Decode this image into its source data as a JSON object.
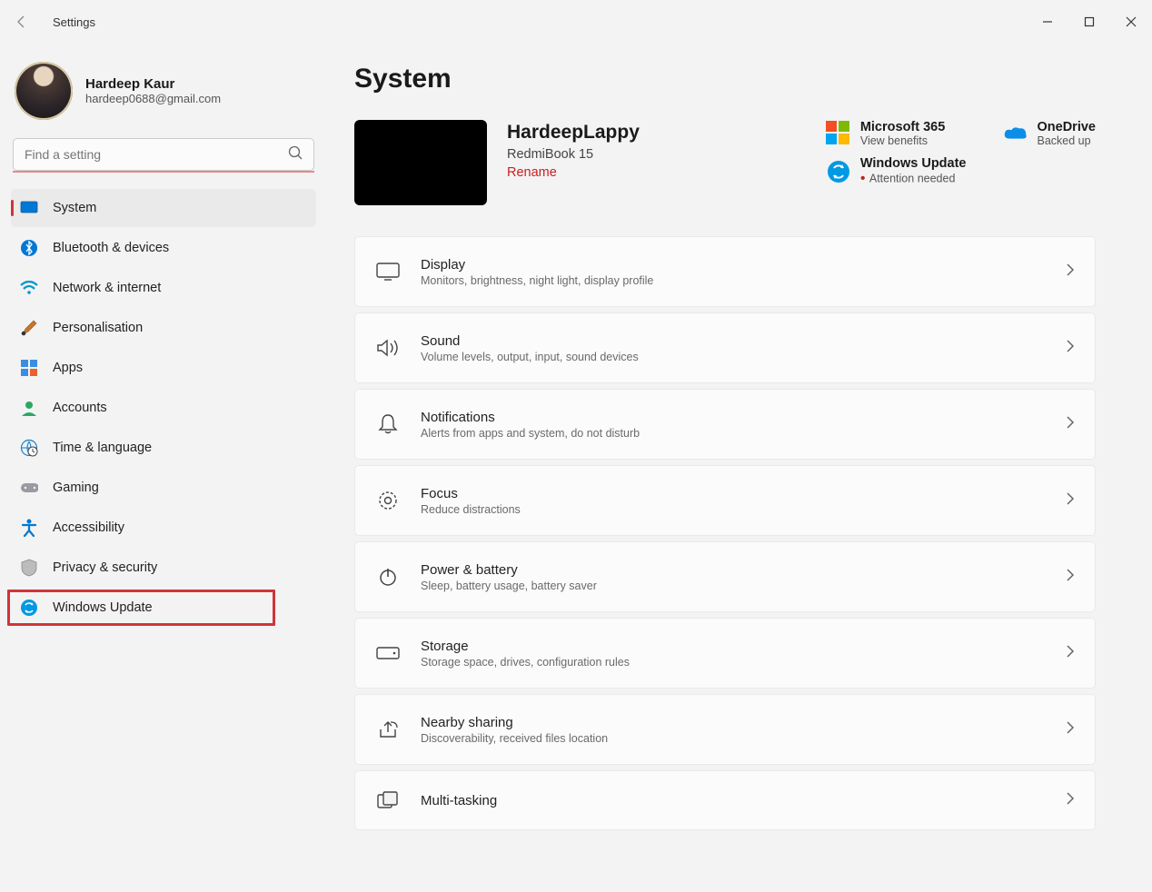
{
  "window": {
    "title": "Settings"
  },
  "profile": {
    "name": "Hardeep Kaur",
    "email": "hardeep0688@gmail.com"
  },
  "search": {
    "placeholder": "Find a setting"
  },
  "sidebar": {
    "items": [
      {
        "label": "System"
      },
      {
        "label": "Bluetooth & devices"
      },
      {
        "label": "Network & internet"
      },
      {
        "label": "Personalisation"
      },
      {
        "label": "Apps"
      },
      {
        "label": "Accounts"
      },
      {
        "label": "Time & language"
      },
      {
        "label": "Gaming"
      },
      {
        "label": "Accessibility"
      },
      {
        "label": "Privacy & security"
      },
      {
        "label": "Windows Update"
      }
    ]
  },
  "page": {
    "title": "System"
  },
  "device": {
    "name": "HardeepLappy",
    "model": "RedmiBook 15",
    "rename": "Rename"
  },
  "status": {
    "ms365": {
      "title": "Microsoft 365",
      "sub": "View benefits"
    },
    "onedrive": {
      "title": "OneDrive",
      "sub": "Backed up"
    },
    "update": {
      "title": "Windows Update",
      "sub": "Attention needed"
    }
  },
  "cards": [
    {
      "title": "Display",
      "sub": "Monitors, brightness, night light, display profile"
    },
    {
      "title": "Sound",
      "sub": "Volume levels, output, input, sound devices"
    },
    {
      "title": "Notifications",
      "sub": "Alerts from apps and system, do not disturb"
    },
    {
      "title": "Focus",
      "sub": "Reduce distractions"
    },
    {
      "title": "Power & battery",
      "sub": "Sleep, battery usage, battery saver"
    },
    {
      "title": "Storage",
      "sub": "Storage space, drives, configuration rules"
    },
    {
      "title": "Nearby sharing",
      "sub": "Discoverability, received files location"
    },
    {
      "title": "Multi-tasking",
      "sub": ""
    }
  ]
}
